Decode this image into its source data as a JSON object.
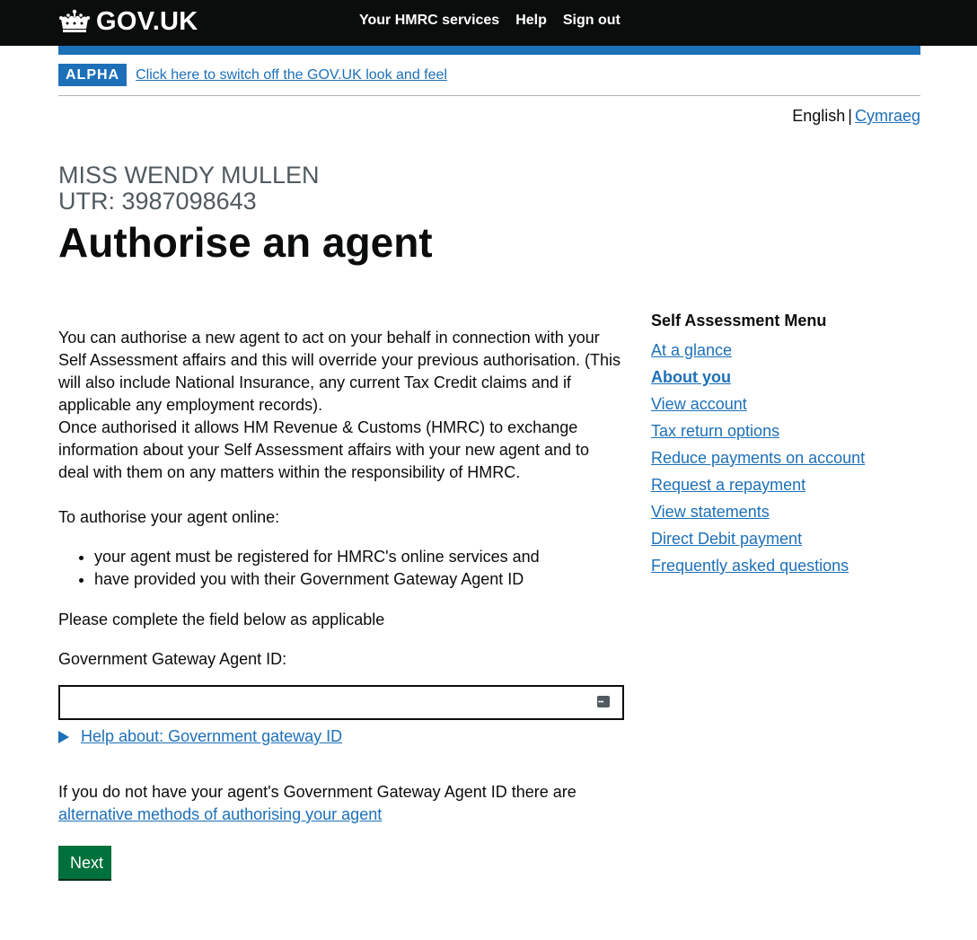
{
  "header": {
    "logo_text": "GOV.UK",
    "nav": [
      "Your HMRC services",
      "Help",
      "Sign out"
    ]
  },
  "phase": {
    "tag": "ALPHA",
    "link": "Click here to switch off the GOV.UK look and feel"
  },
  "language": {
    "current": "English",
    "separator": "|",
    "other": "Cymraeg"
  },
  "caption": {
    "name": "MISS WENDY MULLEN",
    "utr": "UTR: 3987098643"
  },
  "title": "Authorise an agent",
  "main": {
    "intro_1": "You can authorise a new agent to act on your behalf in connection with your Self Assessment affairs and this will override your previous authorisation. (This will also include National Insurance, any current Tax Credit claims and if applicable any employment records).",
    "intro_2": "Once authorised it allows HM Revenue & Customs (HMRC) to exchange information about your Self Assessment affairs with your new agent and to deal with them on any matters within the responsibility of HMRC.",
    "how": "To authorise your agent online:",
    "bullets": [
      "your agent must be registered for HMRC's online services and",
      "have provided you with their Government Gateway Agent ID"
    ],
    "complete": "Please complete the field below as applicable",
    "field_label": "Government Gateway Agent ID:",
    "field_value": "",
    "help_link": "Help about: Government gateway ID",
    "alt_text": "If you do not have your agent's Government Gateway Agent ID there are",
    "alt_link": "alternative methods of authorising your agent",
    "next_button": "Next"
  },
  "sidebar": {
    "heading": "Self Assessment Menu",
    "items": [
      {
        "label": "At a glance",
        "active": false
      },
      {
        "label": "About you",
        "active": true
      },
      {
        "label": "View account",
        "active": false
      },
      {
        "label": "Tax return options",
        "active": false
      },
      {
        "label": "Reduce payments on account",
        "active": false
      },
      {
        "label": "Request a repayment",
        "active": false
      },
      {
        "label": "View statements",
        "active": false
      },
      {
        "label": "Direct Debit payment",
        "active": false
      },
      {
        "label": "Frequently asked questions",
        "active": false
      }
    ]
  },
  "colors": {
    "header_bg": "#0b0c0c",
    "brand_blue": "#1d70b8",
    "button_green": "#00703c",
    "caption_grey": "#505a5f"
  },
  "icons": [
    "crown-icon",
    "password-manager-icon",
    "disclosure-triangle-icon"
  ]
}
